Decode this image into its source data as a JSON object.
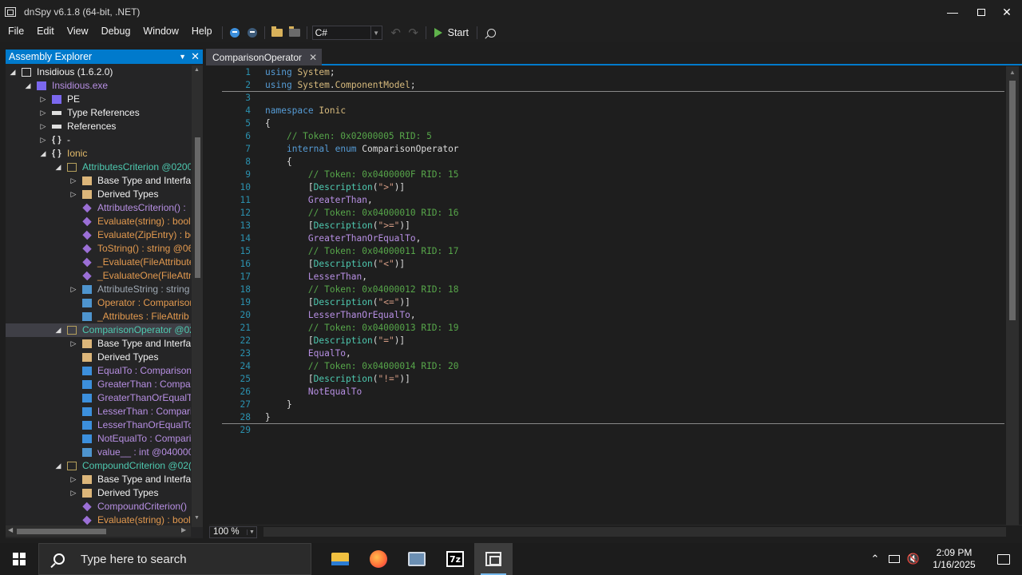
{
  "window": {
    "title": "dnSpy v6.1.8 (64-bit, .NET)",
    "controls": [
      "minimize-icon",
      "restore-icon",
      "close-icon"
    ]
  },
  "menu": {
    "items": [
      "File",
      "Edit",
      "View",
      "Debug",
      "Window",
      "Help"
    ]
  },
  "toolbar": {
    "language": "C#",
    "start_label": "Start",
    "icons": [
      "back-icon",
      "forward-icon",
      "open-icon",
      "open-list-icon",
      "undo-icon",
      "redo-icon",
      "start-icon",
      "search-icon"
    ]
  },
  "explorer": {
    "title": "Assembly Explorer",
    "rows": [
      {
        "label": "Insidious (1.6.2.0)",
        "expander": "◢",
        "icon": "assembly-icon",
        "color": "white"
      },
      {
        "label": "Insidious.exe",
        "expander": "◢",
        "icon": "module-icon",
        "color": "purple"
      },
      {
        "label": "PE",
        "expander": "▷",
        "icon": "pe-icon",
        "color": "white"
      },
      {
        "label": "Type References",
        "expander": "▷",
        "icon": "references-icon",
        "color": "white"
      },
      {
        "label": "References",
        "expander": "▷",
        "icon": "references-icon",
        "color": "white"
      },
      {
        "label": "-",
        "expander": "▷",
        "icon": "namespace-icon",
        "color": "white"
      },
      {
        "label": "Ionic",
        "expander": "◢",
        "icon": "namespace-icon",
        "color": "yellow"
      },
      {
        "label": "AttributesCriterion @0200",
        "expander": "◢",
        "icon": "class-icon",
        "color": "type"
      },
      {
        "label": "Base Type and Interfac",
        "expander": "▷",
        "icon": "folder-icon",
        "color": "white"
      },
      {
        "label": "Derived Types",
        "expander": "▷",
        "icon": "folder-icon",
        "color": "white"
      },
      {
        "label": "AttributesCriterion() :",
        "expander": "",
        "icon": "method-icon",
        "color": "purple"
      },
      {
        "label": "Evaluate(string) : bool",
        "expander": "",
        "icon": "method-icon",
        "color": "orange"
      },
      {
        "label": "Evaluate(ZipEntry) : bo",
        "expander": "",
        "icon": "method-icon",
        "color": "orange"
      },
      {
        "label": "ToString() : string @06",
        "expander": "",
        "icon": "method-icon",
        "color": "orange"
      },
      {
        "label": "_Evaluate(FileAttribute",
        "expander": "",
        "icon": "method-icon",
        "color": "orange"
      },
      {
        "label": "_EvaluateOne(FileAttri",
        "expander": "",
        "icon": "method-icon",
        "color": "orange"
      },
      {
        "label": "AttributeString : string",
        "expander": "▷",
        "icon": "property-icon",
        "color": "gray"
      },
      {
        "label": "Operator : Comparisor",
        "expander": "",
        "icon": "field-icon",
        "color": "orange"
      },
      {
        "label": "_Attributes : FileAttrib",
        "expander": "",
        "icon": "field-icon",
        "color": "orange"
      },
      {
        "label": "ComparisonOperator @02",
        "expander": "◢",
        "icon": "enum-icon",
        "color": "type",
        "selected": true
      },
      {
        "label": "Base Type and Interfac",
        "expander": "▷",
        "icon": "folder-icon",
        "color": "white"
      },
      {
        "label": "Derived Types",
        "expander": "",
        "icon": "folder-icon",
        "color": "white"
      },
      {
        "label": "EqualTo : Comparison",
        "expander": "",
        "icon": "enum-value-icon",
        "color": "purple"
      },
      {
        "label": "GreaterThan : Compar",
        "expander": "",
        "icon": "enum-value-icon",
        "color": "purple"
      },
      {
        "label": "GreaterThanOrEqualTo",
        "expander": "",
        "icon": "enum-value-icon",
        "color": "purple"
      },
      {
        "label": "LesserThan : Comparis",
        "expander": "",
        "icon": "enum-value-icon",
        "color": "purple"
      },
      {
        "label": "LesserThanOrEqualTo :",
        "expander": "",
        "icon": "enum-value-icon",
        "color": "purple"
      },
      {
        "label": "NotEqualTo : Compari",
        "expander": "",
        "icon": "enum-value-icon",
        "color": "purple"
      },
      {
        "label": "value__ : int @0400000",
        "expander": "",
        "icon": "field-icon",
        "color": "purple"
      },
      {
        "label": "CompoundCriterion @02(",
        "expander": "◢",
        "icon": "class-icon",
        "color": "type"
      },
      {
        "label": "Base Type and Interfac",
        "expander": "▷",
        "icon": "folder-icon",
        "color": "white"
      },
      {
        "label": "Derived Types",
        "expander": "▷",
        "icon": "folder-icon",
        "color": "white"
      },
      {
        "label": "CompoundCriterion()",
        "expander": "",
        "icon": "method-icon",
        "color": "purple"
      },
      {
        "label": "Evaluate(string) : bool",
        "expander": "",
        "icon": "method-icon",
        "color": "orange"
      }
    ]
  },
  "document": {
    "tab_label": "ComparisonOperator",
    "zoom": "100 %",
    "lines": [
      {
        "n": "1",
        "parts": [
          [
            "kw",
            "using"
          ],
          [
            "plain",
            " "
          ],
          [
            "ns",
            "System"
          ],
          [
            "plain",
            ";"
          ]
        ]
      },
      {
        "n": "2",
        "parts": [
          [
            "kw",
            "using"
          ],
          [
            "plain",
            " "
          ],
          [
            "ns",
            "System"
          ],
          [
            "plain",
            "."
          ],
          [
            "ns",
            "ComponentModel"
          ],
          [
            "plain",
            ";"
          ]
        ]
      },
      {
        "n": "3",
        "parts": []
      },
      {
        "n": "4",
        "parts": [
          [
            "kw",
            "namespace"
          ],
          [
            "plain",
            " "
          ],
          [
            "ns",
            "Ionic"
          ]
        ]
      },
      {
        "n": "5",
        "parts": [
          [
            "plain",
            "{"
          ]
        ]
      },
      {
        "n": "6",
        "parts": [
          [
            "plain",
            "    "
          ],
          [
            "com",
            "// Token: 0x02000005 RID: 5"
          ]
        ]
      },
      {
        "n": "7",
        "parts": [
          [
            "plain",
            "    "
          ],
          [
            "kw",
            "internal"
          ],
          [
            "plain",
            " "
          ],
          [
            "kw",
            "enum"
          ],
          [
            "plain",
            " "
          ],
          [
            "enumtype",
            "ComparisonOperator"
          ]
        ]
      },
      {
        "n": "8",
        "parts": [
          [
            "plain",
            "    {"
          ]
        ]
      },
      {
        "n": "9",
        "parts": [
          [
            "plain",
            "        "
          ],
          [
            "com",
            "// Token: 0x0400000F RID: 15"
          ]
        ]
      },
      {
        "n": "10",
        "parts": [
          [
            "plain",
            "        ["
          ],
          [
            "type",
            "Description"
          ],
          [
            "plain",
            "("
          ],
          [
            "str",
            "\">\""
          ],
          [
            "plain",
            ")]"
          ]
        ]
      },
      {
        "n": "11",
        "parts": [
          [
            "plain",
            "        "
          ],
          [
            "member",
            "GreaterThan"
          ],
          [
            "plain",
            ","
          ]
        ]
      },
      {
        "n": "12",
        "parts": [
          [
            "plain",
            "        "
          ],
          [
            "com",
            "// Token: 0x04000010 RID: 16"
          ]
        ]
      },
      {
        "n": "13",
        "parts": [
          [
            "plain",
            "        ["
          ],
          [
            "type",
            "Description"
          ],
          [
            "plain",
            "("
          ],
          [
            "str",
            "\">=\""
          ],
          [
            "plain",
            ")]"
          ]
        ]
      },
      {
        "n": "14",
        "parts": [
          [
            "plain",
            "        "
          ],
          [
            "member",
            "GreaterThanOrEqualTo"
          ],
          [
            "plain",
            ","
          ]
        ]
      },
      {
        "n": "15",
        "parts": [
          [
            "plain",
            "        "
          ],
          [
            "com",
            "// Token: 0x04000011 RID: 17"
          ]
        ]
      },
      {
        "n": "16",
        "parts": [
          [
            "plain",
            "        ["
          ],
          [
            "type",
            "Description"
          ],
          [
            "plain",
            "("
          ],
          [
            "str",
            "\"<\""
          ],
          [
            "plain",
            ")]"
          ]
        ]
      },
      {
        "n": "17",
        "parts": [
          [
            "plain",
            "        "
          ],
          [
            "member",
            "LesserThan"
          ],
          [
            "plain",
            ","
          ]
        ]
      },
      {
        "n": "18",
        "parts": [
          [
            "plain",
            "        "
          ],
          [
            "com",
            "// Token: 0x04000012 RID: 18"
          ]
        ]
      },
      {
        "n": "19",
        "parts": [
          [
            "plain",
            "        ["
          ],
          [
            "type",
            "Description"
          ],
          [
            "plain",
            "("
          ],
          [
            "str",
            "\"<=\""
          ],
          [
            "plain",
            ")]"
          ]
        ]
      },
      {
        "n": "20",
        "parts": [
          [
            "plain",
            "        "
          ],
          [
            "member",
            "LesserThanOrEqualTo"
          ],
          [
            "plain",
            ","
          ]
        ]
      },
      {
        "n": "21",
        "parts": [
          [
            "plain",
            "        "
          ],
          [
            "com",
            "// Token: 0x04000013 RID: 19"
          ]
        ]
      },
      {
        "n": "22",
        "parts": [
          [
            "plain",
            "        ["
          ],
          [
            "type",
            "Description"
          ],
          [
            "plain",
            "("
          ],
          [
            "str",
            "\"=\""
          ],
          [
            "plain",
            ")]"
          ]
        ]
      },
      {
        "n": "23",
        "parts": [
          [
            "plain",
            "        "
          ],
          [
            "member",
            "EqualTo"
          ],
          [
            "plain",
            ","
          ]
        ]
      },
      {
        "n": "24",
        "parts": [
          [
            "plain",
            "        "
          ],
          [
            "com",
            "// Token: 0x04000014 RID: 20"
          ]
        ]
      },
      {
        "n": "25",
        "parts": [
          [
            "plain",
            "        ["
          ],
          [
            "type",
            "Description"
          ],
          [
            "plain",
            "("
          ],
          [
            "str",
            "\"!=\""
          ],
          [
            "plain",
            ")]"
          ]
        ]
      },
      {
        "n": "26",
        "parts": [
          [
            "plain",
            "        "
          ],
          [
            "member",
            "NotEqualTo"
          ]
        ]
      },
      {
        "n": "27",
        "parts": [
          [
            "plain",
            "    }"
          ]
        ]
      },
      {
        "n": "28",
        "parts": [
          [
            "plain",
            "}"
          ]
        ]
      },
      {
        "n": "29",
        "parts": []
      }
    ]
  },
  "taskbar": {
    "search_placeholder": "Type here to search",
    "apps": [
      "file-explorer-icon",
      "firefox-icon",
      "virtual-machine-icon",
      "7zip-icon",
      "dnspy-icon"
    ],
    "tray_icons": [
      "chevron-up-icon",
      "network-icon",
      "volume-muted-icon"
    ],
    "time": "2:09 PM",
    "date": "1/16/2025",
    "seven_zip_label": "7z"
  },
  "colors": {
    "accent": "#007acc",
    "background": "#1e1e1e",
    "panel": "#252526",
    "selection": "#3f3f46"
  }
}
